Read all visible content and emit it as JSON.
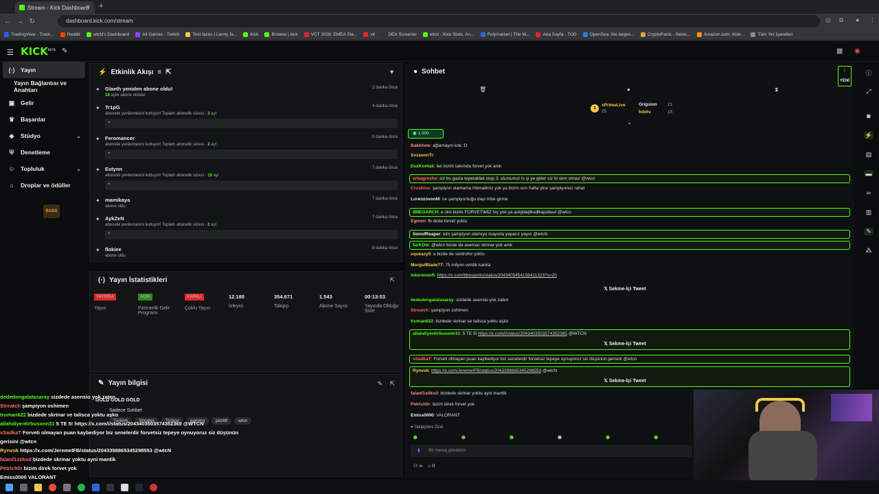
{
  "browser": {
    "tab_title": "Stream - Kick Dashboard",
    "url": "dashboard.kick.com/stream",
    "bookmarks": [
      "TradingView - Track...",
      "Reddit",
      "wtcN's Dashboard",
      "All Games - Twitch",
      "Text faces | Lenny fa...",
      "Kick",
      "Browse | kick",
      "VCT 2026: EMEA Sta...",
      "vlr",
      "DEX Screener",
      "wtcn - Kick Stats, An...",
      "Polymarket | The W...",
      "Ana Sayfa - TOD",
      "OpenSea, the larges...",
      "CryptoPanic - News...",
      "Amazon.com: AVer...",
      "Tüm Yer İşaretleri"
    ]
  },
  "sidebar": {
    "items": [
      {
        "label": "Yayın"
      },
      {
        "label": "Yayın Bağlantısı ve Anahtarı"
      },
      {
        "label": "Gelir"
      },
      {
        "label": "Başarılar"
      },
      {
        "label": "Stüdyo"
      },
      {
        "label": "Denetleme"
      },
      {
        "label": "Topluluk"
      },
      {
        "label": "Droplar ve ödüller"
      }
    ]
  },
  "activity": {
    "title": "Etkinlik Akışı",
    "items": [
      {
        "name": "Glaeth yeniden abone oldu!",
        "desc_num": "18",
        "desc": "aylık abone oldular",
        "time": "2 dakika önce",
        "box": false
      },
      {
        "name": "Tr1pG",
        "desc": "abonelik yenilemesini kutluyor! Toplam abonelik süresi - ",
        "desc_num": "3",
        "desc_tail": " ay!",
        "time": "4 dakika önce",
        "box": true
      },
      {
        "name": "Feromancer",
        "desc": "abonelik yenilemesini kutluyor! Toplam abonelik süresi - ",
        "desc_num": "2",
        "desc_tail": " ay!",
        "time": "5 dakika önce",
        "box": true
      },
      {
        "name": "Estynn",
        "desc": "abonelik yenilemesini kutluyor! Toplam abonelik süresi - ",
        "desc_num": "15",
        "desc_tail": " ay!",
        "time": "7 dakika önce",
        "box": true
      },
      {
        "name": "mamikaya",
        "desc": "abone oldu",
        "time": "7 dakika önce",
        "box": false
      },
      {
        "name": "AykZeN",
        "desc": "abonelik yenilemesini kutluyor! Toplam abonelik süresi - ",
        "desc_num": "2",
        "desc_tail": " ay!",
        "time": "7 dakika önce",
        "box": true
      },
      {
        "name": "flokiee",
        "desc": "abone oldu",
        "time": "8 dakika önce",
        "box": false
      }
    ]
  },
  "stats": {
    "title": "Yayın İstatistikleri",
    "items": [
      {
        "tag": "YAYINDA",
        "tag_color": "#e3262a",
        "label": "Yayın"
      },
      {
        "tag": "AÇIK",
        "tag_color": "#2c8a1a",
        "label": "Partnerlik Gelir Programı"
      },
      {
        "tag": "KAPALI",
        "tag_color": "#e3262a",
        "label": "Çoklu Yayın"
      },
      {
        "value": "12.180",
        "label": "İzleyici"
      },
      {
        "value": "354.671",
        "label": "Takipçi"
      },
      {
        "value": "1.543",
        "label": "Abone Sayısı"
      },
      {
        "value": "00:13:03",
        "label": "Yayında Olduğu Süre"
      }
    ]
  },
  "info": {
    "title": "Yayın bilgisi",
    "title_overlay": "GOLD GOLD GOLD",
    "category": "Sadece Sohbet",
    "tags": [
      "Turkish",
      "Shooter",
      "Türkçe",
      "gaming",
      "pozitif",
      "wtcn"
    ]
  },
  "chat": {
    "title": "Sohbet",
    "new_label": "YENİ",
    "leaderboard": [
      {
        "name": "xPrimeLive",
        "count": "25"
      },
      {
        "name": "Origsion",
        "count": "21"
      },
      {
        "name": "fobitv",
        "count": "15"
      }
    ],
    "pinned_amount": "1.000",
    "messages": [
      {
        "user": "Bakkhele",
        "color": "#ff8a8a",
        "text": "ağlamayın knk :D"
      },
      {
        "user": "SxzaoonTr",
        "color": "#f3c94d",
        "text": ""
      },
      {
        "user": "DuzKontak",
        "color": "#53fc18",
        "text": "lan bizim takımda forvet yok amk"
      },
      {
        "user": "erhagresho",
        "color": "#ff6464",
        "text": "siz bu gazia tepetaklak olup 3. olursunuz ts şi ye gider siz bi skm olmaz @wtcn",
        "boxed": true
      },
      {
        "user": "Crushinc",
        "color": "#ff6464",
        "text": "şampiyon olamama ihtimalimiz yok ya bizim son hafta yine şampiyonuz rahat"
      },
      {
        "user": "LorenzovonM",
        "color": "#eee",
        "text": "ne şampiyonluğu dayı tribe girme"
      },
      {
        "user": "IIMEGARCH",
        "color": "#53fc18",
        "text": "e olm bizim FORVETİMİZ hiç yok ya askjldaijlksdlkajsdasd @wtcn",
        "boxed": true
      },
      {
        "user": "Egmen",
        "color": "#ff8a8a",
        "text": "fb dede forvet yoktu"
      },
      {
        "user": "SonofReaper",
        "color": "#eee",
        "text": "kim şampiyon olamıyo mayısta yaparız yayın @wtcN",
        "boxed": true
      },
      {
        "user": "furKOw",
        "color": "#53fc18",
        "text": "@wtcn bizde de asensio skrinar yok amk",
        "boxed": true
      },
      {
        "user": "squeazy0",
        "color": "#f3c94d",
        "text": "e bizde de santrofor yoktu"
      },
      {
        "user": "MorgulBlade77",
        "color": "#f3c94d",
        "text": "75 milyon verdik kanka"
      },
      {
        "user": "mkeremmft",
        "color": "#53fc18",
        "link": "https://x.com/bbosports/status/2043405454156411323?s=20"
      },
      {
        "user": "dededengalatasaray",
        "color": "#53fc18",
        "text": "sizdede asensio yok zaten"
      },
      {
        "user": "Streatch",
        "color": "#ff6464",
        "text": "şampiyon oshimen"
      },
      {
        "user": "truman622",
        "color": "#53fc18",
        "text": "bizdede skrinar ve talisca yoktu aşko"
      },
      {
        "user": "allahdiyentirbusonn31",
        "color": "#53fc18",
        "text": "5 TE 5! ",
        "link": "https://x.com/i/status/2043403503574352365",
        "tail": " @WTCN",
        "boxed": true
      },
      {
        "user": "xSadkaT",
        "color": "#ff6464",
        "text": "Forveti olmayan puan kaybediyor biz senelerdir forvetsiz tepeye oynuyoruz siz düşünün gerisini @wtcn",
        "boxed": true
      },
      {
        "user": "Rynvok",
        "color": "#f3c94d",
        "link": "https://x.com/JeremeIFB/status/2043398865345298553",
        "tail": " @wtcN",
        "boxed": true
      },
      {
        "user": "falanf1stikxd",
        "color": "#ff8a8a",
        "text": "bizdede skrinar yoktu ayni mantik"
      },
      {
        "user": "Petrich0r",
        "color": "#ff8a8a",
        "text": "bizim direk forvet yok"
      },
      {
        "user": "Emiss0000",
        "color": "#eee",
        "text": "VALORANT"
      }
    ],
    "tweet_label": "Sekme-İçi Tweet",
    "followers_only": "Takipçilere Özel",
    "input_placeholder": "Bir mesaj gönderin",
    "bottom_count": "0"
  },
  "overlay_chat": [
    {
      "user": "dededengalatasaray",
      "color": "#53fc18",
      "text": "sizdede asensio yok zaten"
    },
    {
      "user": "Streatch",
      "color": "#ff7070",
      "text": "şampiyon oshimen"
    },
    {
      "user": "truman622",
      "color": "#53fc18",
      "text": "bizdede skrinar ve talisca yoktu aşko"
    },
    {
      "user": "allahdiyentirbusonn31",
      "color": "#53fc18",
      "text": "5 TE 5! https://x.com/i/status/2043403503574352365 @WTCN"
    },
    {
      "user": "xSadkaT",
      "color": "#ff7070",
      "text": "Forveti olmayan puan kaybediyor biz senelerdir forvetsiz tepeye oynuyoruz siz düşünün"
    },
    {
      "user": "",
      "color": "#fff",
      "text": "gerisini @wtcn"
    },
    {
      "user": "Rynvok",
      "color": "#f3c94d",
      "text": "https://x.com/JeremeIFB/status/2043398865345298553 @wtcN"
    },
    {
      "user": "falanf1stikxd",
      "color": "#ff7070",
      "text": "bizdede skrinar yoktu ayni mantik"
    },
    {
      "user": "Petrich0r",
      "color": "#ff7070",
      "text": "bizim direk forvet yok"
    },
    {
      "user": "Emiss0000",
      "color": "#fff",
      "text": "VALORANT"
    }
  ]
}
